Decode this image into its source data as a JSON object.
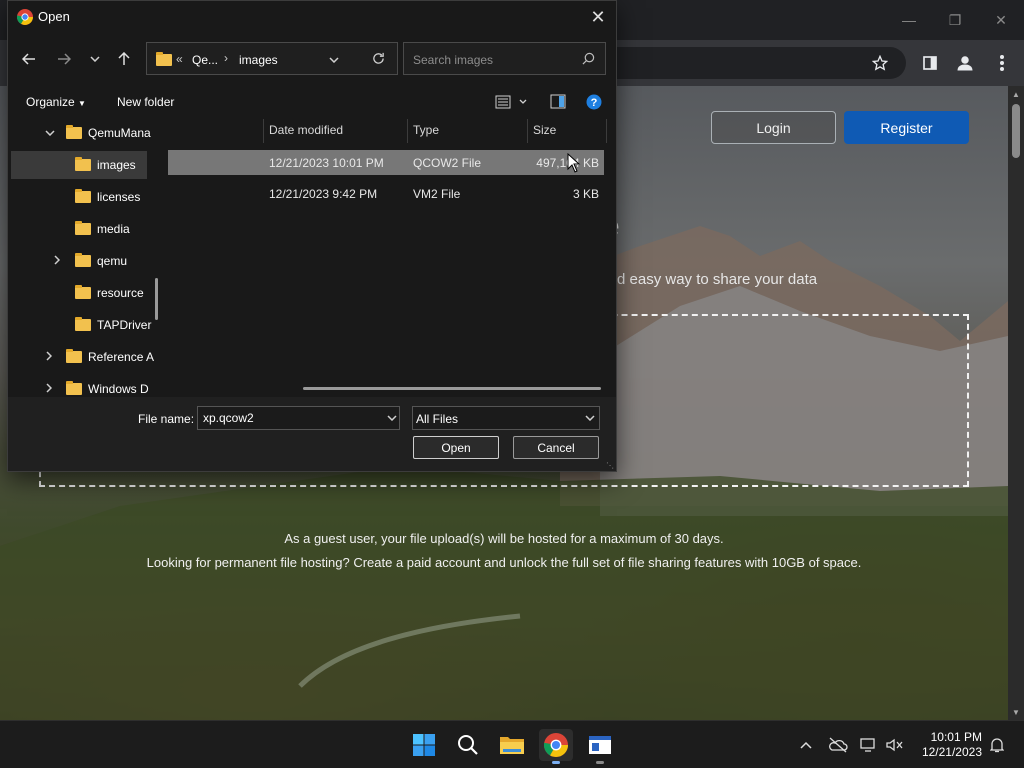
{
  "browser": {
    "window_controls": [
      "minimize-icon",
      "restore-icon",
      "close-icon"
    ],
    "toolbar_icons": [
      "star-icon",
      "side-panel-icon",
      "profile-icon",
      "more-menu-icon"
    ]
  },
  "page": {
    "login_label": "Login",
    "register_label": "Register",
    "hero_title_fragment": "e",
    "hero_subtitle_fragment": "d easy way to share your data",
    "guest_line_1": "As a guest user, your file upload(s) will be hosted for a maximum of 30 days.",
    "guest_line_2": "Looking for permanent file hosting? Create a paid account and unlock the full set of file sharing features with 10GB of space."
  },
  "dialog": {
    "title": "Open",
    "address": {
      "prefix": "«",
      "crumbs": [
        "Qe...",
        "images"
      ]
    },
    "search_placeholder": "Search images",
    "organize_label": "Organize",
    "new_folder_label": "New folder",
    "tree": [
      {
        "label": "QemuMana",
        "level": 1,
        "expanded": true,
        "chevron": "down"
      },
      {
        "label": "images",
        "level": 2,
        "selected": true
      },
      {
        "label": "licenses",
        "level": 2
      },
      {
        "label": "media",
        "level": 2
      },
      {
        "label": "qemu",
        "level": 2,
        "chevron": "right"
      },
      {
        "label": "resource",
        "level": 2
      },
      {
        "label": "TAPDriver",
        "level": 2
      },
      {
        "label": "Reference A",
        "level": 1,
        "chevron": "right"
      },
      {
        "label": "Windows D",
        "level": 1,
        "chevron": "right"
      }
    ],
    "columns": [
      "Date modified",
      "Type",
      "Size"
    ],
    "files": [
      {
        "date": "12/21/2023 10:01 PM",
        "type": "QCOW2 File",
        "size": "497,104 KB",
        "selected": true
      },
      {
        "date": "12/21/2023 9:42 PM",
        "type": "VM2 File",
        "size": "3 KB",
        "selected": false
      }
    ],
    "file_name_label": "File name:",
    "file_name_value": "xp.qcow2",
    "filter_value": "All Files",
    "open_label": "Open",
    "cancel_label": "Cancel"
  },
  "taskbar": {
    "apps": [
      "windows-start-icon",
      "search-icon",
      "file-explorer-icon",
      "chrome-icon",
      "qemu-manager-icon"
    ],
    "time": "10:01 PM",
    "date": "12/21/2023"
  },
  "colors": {
    "register_blue": "#0f5ab4",
    "selection_gray": "#777777",
    "folder_yellow": "#f2c14e",
    "dialog_bg": "#191919"
  }
}
